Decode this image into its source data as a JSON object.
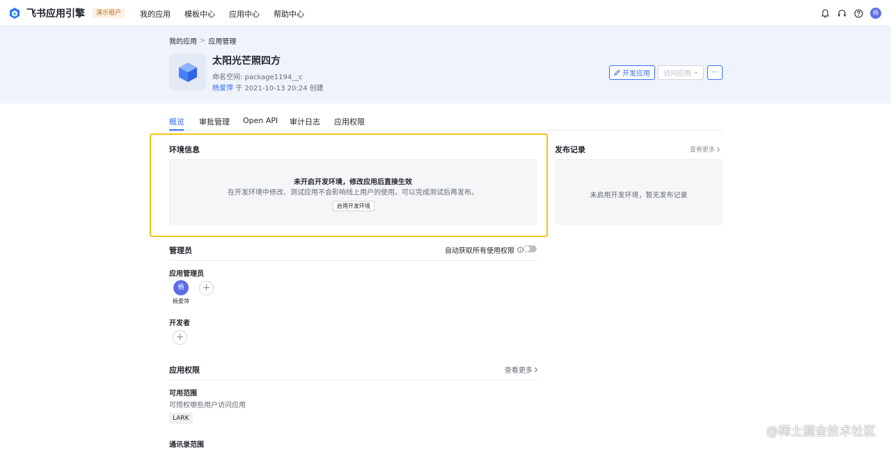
{
  "topnav": {
    "logo_text": "飞书应用引擎",
    "tenant_badge": "演示租户",
    "items": [
      {
        "label": "我的应用"
      },
      {
        "label": "模板中心"
      },
      {
        "label": "应用中心"
      },
      {
        "label": "帮助中心"
      }
    ],
    "user_initial": "杨"
  },
  "breadcrumb": {
    "root": "我的应用",
    "separator": ">",
    "current": "应用管理"
  },
  "app": {
    "title": "太阳光芒照四方",
    "namespace": "命名空间: package1194__c",
    "creator": "杨爱萍",
    "created_text": " 于 2021-10-13 20:24 创建"
  },
  "actions": {
    "develop_label": "开发应用",
    "visit_label": "访问应用",
    "more_label": "···"
  },
  "tabs": [
    {
      "label": "概览",
      "active": true
    },
    {
      "label": "审批管理",
      "active": false
    },
    {
      "label": "Open API",
      "active": false
    },
    {
      "label": "审计日志",
      "active": false
    },
    {
      "label": "应用权限",
      "active": false
    }
  ],
  "env": {
    "title": "环境信息",
    "headline": "未开启开发环境，修改应用后直接生效",
    "description": "在开发环境中修改、测试应用不会影响线上用户的使用。可以完成测试后再发布。",
    "button_label": "启用开发环境"
  },
  "release": {
    "title": "发布记录",
    "more_label": "查看更多",
    "empty_text": "未启用开发环境，暂无发布记录"
  },
  "admins": {
    "title": "管理员",
    "auto_perm_label": "自动获取所有使用权限",
    "auto_perm_enabled": false,
    "app_admin_title": "应用管理员",
    "app_admin": {
      "initial": "杨",
      "name": "杨爱萍"
    },
    "developer_title": "开发者",
    "add_symbol": "+"
  },
  "permissions": {
    "title": "应用权限",
    "more_label": "查看更多",
    "scope_title": "可用范围",
    "scope_desc": "可授权哪些用户访问应用",
    "scope_tag": "LARK",
    "contacts_title": "通讯录范围"
  },
  "watermark": "@稀土掘金技术社区",
  "colors": {
    "accent": "#3370ff",
    "highlight": "#f2c318",
    "header_bg": "#eff3fc",
    "tenant_badge_bg": "#fdf0e0",
    "avatar": "#5b6ee6"
  }
}
